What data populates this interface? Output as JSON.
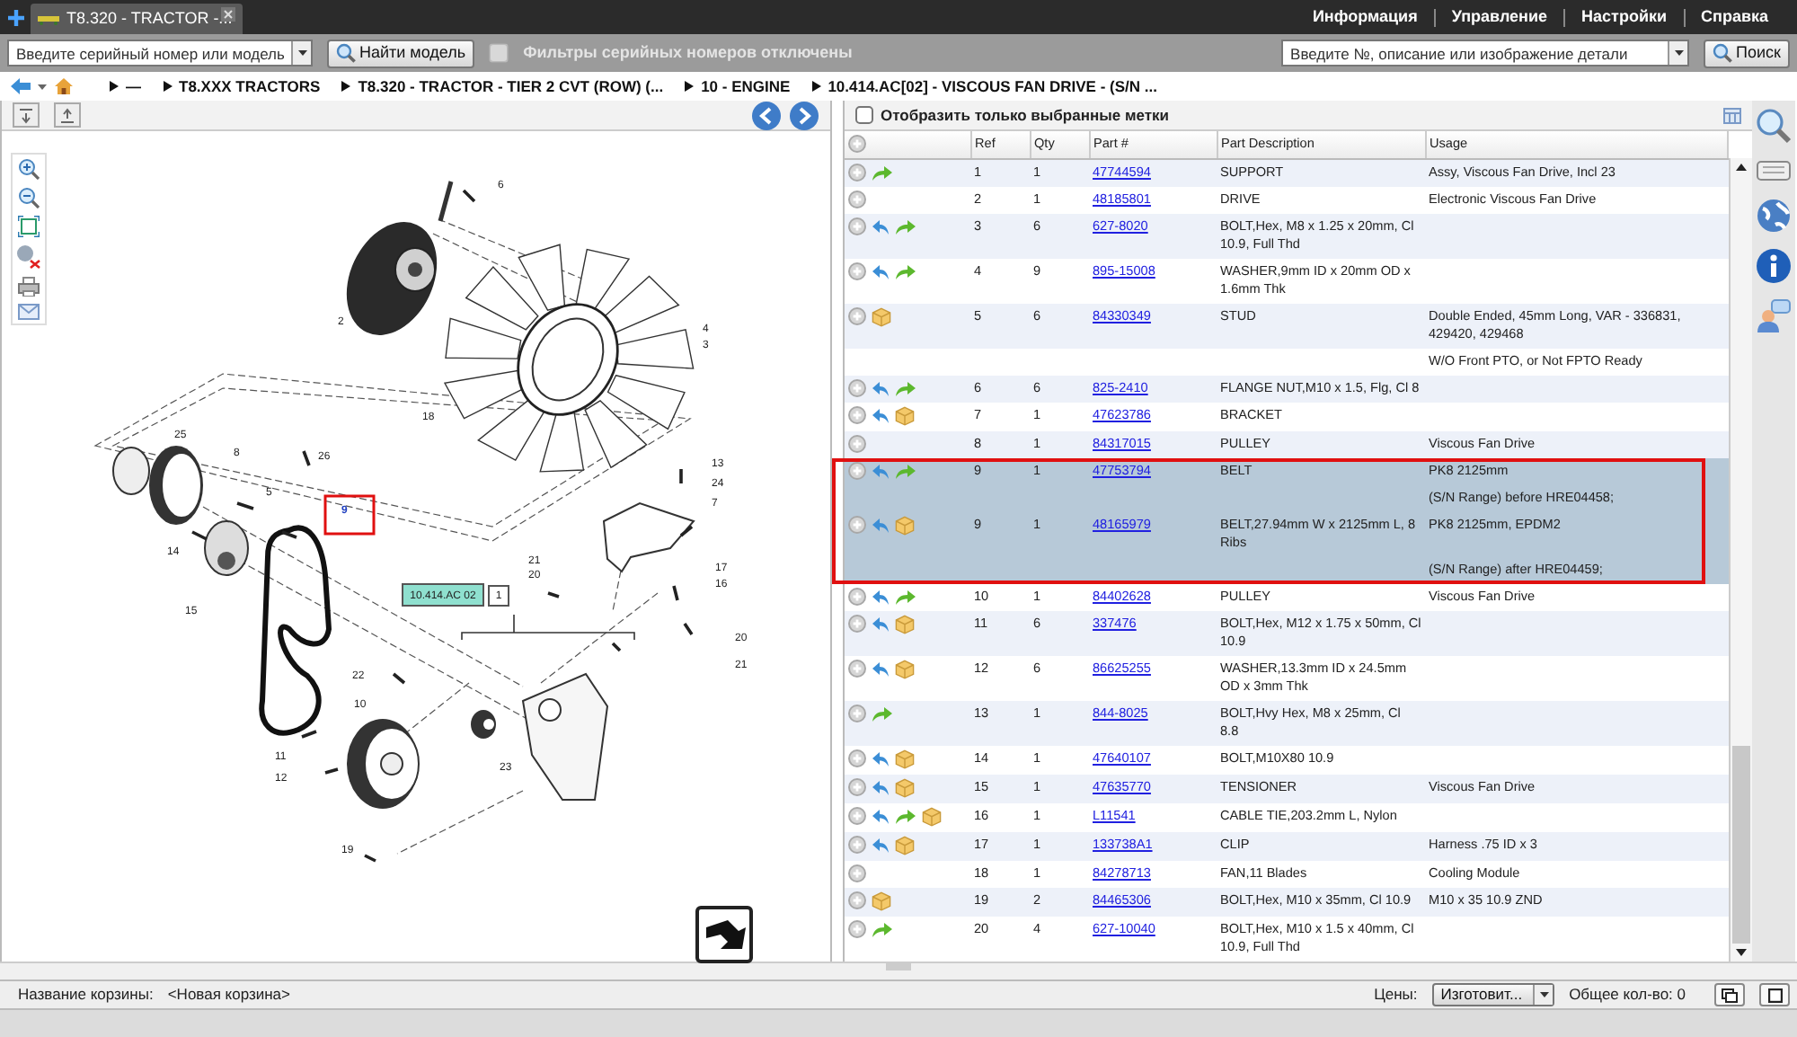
{
  "tabs": [
    {
      "label": "T8.320 - TRACTOR -...",
      "selected": true
    }
  ],
  "top_menu": [
    "Информация",
    "Управление",
    "Настройки",
    "Справка"
  ],
  "model_search": {
    "placeholder": "Введите серийный номер или модель",
    "button": "Найти модель"
  },
  "serial_filter": {
    "label": "Фильтры серийных номеров отключены",
    "checked": false,
    "disabled": true
  },
  "part_search": {
    "placeholder": "Введите №, описание или изображение детали",
    "button": "Поиск"
  },
  "breadcrumb": [
    "—",
    "T8.XXX TRACTORS",
    "T8.320 - TRACTOR - TIER 2 CVT (ROW) (...",
    "10 - ENGINE",
    "10.414.AC[02] - VISCOUS FAN DRIVE - (S/N ..."
  ],
  "diagram": {
    "callouts": [
      {
        "label": "6",
        "selected": false
      },
      {
        "label": "2",
        "selected": false
      },
      {
        "label": "18",
        "selected": false
      },
      {
        "label": "4",
        "selected": false
      },
      {
        "label": "3",
        "selected": false
      },
      {
        "label": "25",
        "selected": false
      },
      {
        "label": "8",
        "selected": false
      },
      {
        "label": "26",
        "selected": false
      },
      {
        "label": "5",
        "selected": false
      },
      {
        "label": "9",
        "selected": true
      },
      {
        "label": "14",
        "selected": false
      },
      {
        "label": "15",
        "selected": false
      },
      {
        "label": "13",
        "selected": false
      },
      {
        "label": "24",
        "selected": false
      },
      {
        "label": "7",
        "selected": false
      },
      {
        "label": "21",
        "selected": false
      },
      {
        "label": "20",
        "selected": false
      },
      {
        "label": "17",
        "selected": false
      },
      {
        "label": "16",
        "selected": false
      },
      {
        "label": "20",
        "selected": false
      },
      {
        "label": "21",
        "selected": false
      },
      {
        "label": "22",
        "selected": false
      },
      {
        "label": "10",
        "selected": false
      },
      {
        "label": "11",
        "selected": false
      },
      {
        "label": "12",
        "selected": false
      },
      {
        "label": "23",
        "selected": false
      },
      {
        "label": "19",
        "selected": false
      }
    ],
    "section_label": "10.414.AC 02",
    "section_count": "1"
  },
  "parts_list": {
    "filter": {
      "label": "Отобразить только выбранные метки",
      "checked": false
    },
    "columns": [
      "Ref",
      "Qty",
      "Part #",
      "Part Description",
      "Usage"
    ],
    "rows": [
      {
        "kind": "part",
        "icons": [
          {
            "kind": "forward"
          }
        ],
        "ref": "1",
        "qty": "1",
        "part": "47744594",
        "description": "SUPPORT",
        "usage": "Assy, Viscous Fan Drive, Incl 23",
        "selected": false
      },
      {
        "kind": "part",
        "icons": [],
        "ref": "2",
        "qty": "1",
        "part": "48185801",
        "description": "DRIVE",
        "usage": "Electronic Viscous Fan Drive",
        "selected": false
      },
      {
        "kind": "part",
        "icons": [
          {
            "kind": "reply"
          },
          {
            "kind": "forward"
          }
        ],
        "ref": "3",
        "qty": "6",
        "part": "627-8020",
        "description": "BOLT,Hex, M8 x 1.25 x 20mm, Cl 10.9, Full Thd",
        "selected": false
      },
      {
        "kind": "part",
        "icons": [
          {
            "kind": "reply"
          },
          {
            "kind": "forward"
          }
        ],
        "ref": "4",
        "qty": "9",
        "part": "895-15008",
        "description": "WASHER,9mm ID x 20mm OD x 1.6mm Thk",
        "selected": false
      },
      {
        "kind": "part",
        "icons": [
          {
            "kind": "package"
          }
        ],
        "ref": "5",
        "qty": "6",
        "part": "84330349",
        "description": "STUD",
        "usage": "Double Ended, 45mm Long, VAR - 336831, 429420, 429468",
        "selected": false
      },
      {
        "kind": "note",
        "usage": "W/O Front PTO, or Not FPTO Ready",
        "selected": false
      },
      {
        "kind": "part",
        "icons": [
          {
            "kind": "reply"
          },
          {
            "kind": "forward"
          }
        ],
        "ref": "6",
        "qty": "6",
        "part": "825-2410",
        "description": "FLANGE NUT,M10 x 1.5, Flg, Cl 8",
        "selected": false
      },
      {
        "kind": "part",
        "icons": [
          {
            "kind": "reply"
          },
          {
            "kind": "package"
          }
        ],
        "ref": "7",
        "qty": "1",
        "part": "47623786",
        "description": "BRACKET",
        "selected": false
      },
      {
        "kind": "part",
        "icons": [],
        "ref": "8",
        "qty": "1",
        "part": "84317015",
        "description": "PULLEY",
        "usage": "Viscous Fan Drive",
        "selected": false
      },
      {
        "kind": "part",
        "icons": [
          {
            "kind": "reply"
          },
          {
            "kind": "forward"
          }
        ],
        "ref": "9",
        "qty": "1",
        "part": "47753794",
        "description": "BELT",
        "usage": "PK8 2125mm",
        "selected": true
      },
      {
        "kind": "note",
        "usage": "(S/N Range) before HRE04458;",
        "selected": true
      },
      {
        "kind": "part",
        "icons": [
          {
            "kind": "reply"
          },
          {
            "kind": "package"
          }
        ],
        "ref": "9",
        "qty": "1",
        "part": "48165979",
        "description": "BELT,27.94mm W x 2125mm L, 8 Ribs",
        "usage": "PK8 2125mm, EPDM2",
        "selected": true
      },
      {
        "kind": "note",
        "usage": "(S/N Range) after HRE04459;",
        "selected": true
      },
      {
        "kind": "part",
        "icons": [
          {
            "kind": "reply"
          },
          {
            "kind": "forward"
          }
        ],
        "ref": "10",
        "qty": "1",
        "part": "84402628",
        "description": "PULLEY",
        "usage": "Viscous Fan Drive",
        "selected": false
      },
      {
        "kind": "part",
        "icons": [
          {
            "kind": "reply"
          },
          {
            "kind": "package"
          }
        ],
        "ref": "11",
        "qty": "6",
        "part": "337476",
        "description": "BOLT,Hex, M12 x 1.75 x 50mm, Cl 10.9",
        "selected": false
      },
      {
        "kind": "part",
        "icons": [
          {
            "kind": "reply"
          },
          {
            "kind": "package"
          }
        ],
        "ref": "12",
        "qty": "6",
        "part": "86625255",
        "description": "WASHER,13.3mm ID x 24.5mm OD x 3mm Thk",
        "selected": false
      },
      {
        "kind": "part",
        "icons": [
          {
            "kind": "forward"
          }
        ],
        "ref": "13",
        "qty": "1",
        "part": "844-8025",
        "description": "BOLT,Hvy Hex, M8 x 25mm, Cl 8.8",
        "selected": false
      },
      {
        "kind": "part",
        "icons": [
          {
            "kind": "reply"
          },
          {
            "kind": "package"
          }
        ],
        "ref": "14",
        "qty": "1",
        "part": "47640107",
        "description": "BOLT,M10X80 10.9",
        "selected": false
      },
      {
        "kind": "part",
        "icons": [
          {
            "kind": "reply"
          },
          {
            "kind": "package"
          }
        ],
        "ref": "15",
        "qty": "1",
        "part": "47635770",
        "description": "TENSIONER",
        "usage": "Viscous Fan Drive",
        "selected": false
      },
      {
        "kind": "part",
        "icons": [
          {
            "kind": "reply"
          },
          {
            "kind": "forward"
          },
          {
            "kind": "package"
          }
        ],
        "ref": "16",
        "qty": "1",
        "part": "L11541",
        "description": "CABLE TIE,203.2mm L, Nylon",
        "selected": false
      },
      {
        "kind": "part",
        "icons": [
          {
            "kind": "reply"
          },
          {
            "kind": "package"
          }
        ],
        "ref": "17",
        "qty": "1",
        "part": "133738A1",
        "description": "CLIP",
        "usage": "Harness .75 ID x 3",
        "selected": false
      },
      {
        "kind": "part",
        "icons": [],
        "ref": "18",
        "qty": "1",
        "part": "84278713",
        "description": "FAN,11 Blades",
        "usage": "Cooling Module",
        "selected": false
      },
      {
        "kind": "part",
        "icons": [
          {
            "kind": "package"
          }
        ],
        "ref": "19",
        "qty": "2",
        "part": "84465306",
        "description": "BOLT,Hex, M10 x 35mm, Cl 10.9",
        "usage": "M10 x 35 10.9 ZND",
        "selected": false
      },
      {
        "kind": "part",
        "icons": [
          {
            "kind": "forward"
          }
        ],
        "ref": "20",
        "qty": "4",
        "part": "627-10040",
        "description": "BOLT,Hex, M10 x 1.5 x 40mm, Cl 10.9, Full Thd",
        "selected": false
      }
    ]
  },
  "basket": {
    "label": "Название корзины:",
    "name": "<Новая корзина>",
    "prices_label": "Цены:",
    "prices_value": "Изготовит...",
    "total": "Общее кол-во: 0"
  }
}
